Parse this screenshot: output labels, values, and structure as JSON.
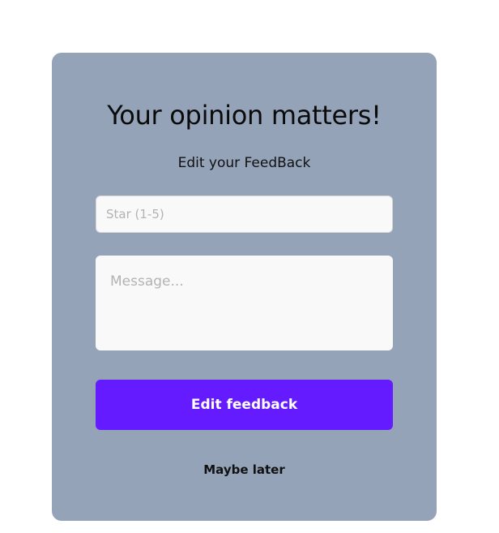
{
  "feedback_card": {
    "title": "Your opinion matters!",
    "subtitle": "Edit your FeedBack",
    "star_input": {
      "value": "",
      "placeholder": "Star (1-5)"
    },
    "message_input": {
      "value": "",
      "placeholder": "Message..."
    },
    "submit_label": "Edit feedback",
    "later_label": "Maybe later"
  },
  "colors": {
    "card_background": "#94a3b8",
    "button_background": "#651bff",
    "button_text": "#ffffff",
    "input_background": "#f9f9f9"
  }
}
